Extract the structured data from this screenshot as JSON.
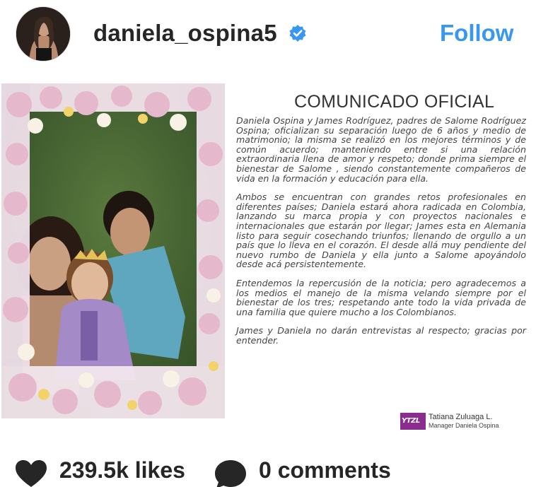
{
  "header": {
    "username": "daniela_ospina5",
    "verified": true,
    "follow_label": "Follow"
  },
  "colors": {
    "follow_blue": "#3897f0",
    "verified_blue": "#3897f0",
    "text_dark": "#262626",
    "signature_purple": "#8a2d8f"
  },
  "post": {
    "notice": {
      "title": "COMUNICADO OFICIAL",
      "paragraphs": [
        "Daniela Ospina y James Rodríguez, padres de Salome Rodríguez Ospina; oficializan su separación luego de 6 años y medio de matrimonio; la misma se realizó en los mejores términos y de común acuerdo; manteniendo entre si una relación extraordinaria llena de amor y respeto; donde prima siempre el bienestar de Salome , siendo constantemente compañeros de vida en la formación y educación para ella.",
        "Ambos se encuentran con grandes retos profesionales en diferentes países; Daniela estará ahora radicada en Colombia, lanzando su marca propia y con proyectos nacionales e internacionales que estarán por llegar; James esta en Alemania listo para seguir cosechando triunfos; llenando de orgullo a un país que lo lleva en el corazón. El desde allá muy pendiente del nuevo rumbo de Daniela y ella junto a Salome apoyándolo desde acá persistentemente.",
        "Entendemos la repercusión de la noticia; pero agradecemos a los medios el manejo de la misma velando siempre por el bienestar de los tres; respetando ante todo la vida privada de una familia que quiere mucho a los Colombianos.",
        "James y Daniela no darán entrevistas al respecto; gracias por entender."
      ],
      "signature": {
        "logo_text": "YTZL",
        "name": "Tatiana Zuluaga L.",
        "role": "Manager Daniela Ospina"
      }
    }
  },
  "footer": {
    "heart_icon": "heart-icon",
    "likes": "239.5k likes",
    "comment_icon": "comment-bubble-icon",
    "comments": "0 comments"
  }
}
